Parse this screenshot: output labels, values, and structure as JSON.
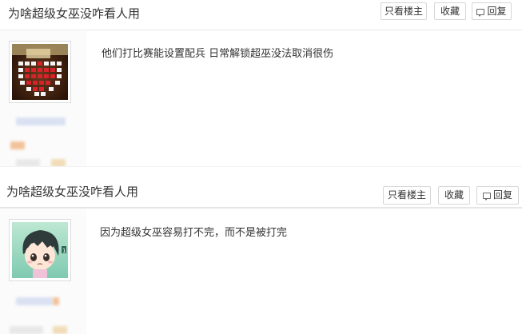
{
  "threads": [
    {
      "title": "为啥超级女巫没咋看人用",
      "buttons": {
        "only_op": "只看楼主",
        "favorite": "收藏",
        "reply": "回复"
      },
      "post": {
        "text": "他们打比赛能设置配兵 日常解锁超巫没法取消很伤"
      },
      "avatar_icon": "pixel-heart-avatar"
    },
    {
      "title": "为啥超级女巫没咋看人用",
      "buttons": {
        "only_op": "只看楼主",
        "favorite": "收藏",
        "reply": "回复"
      },
      "post": {
        "text": "因为超级女巫容易打不完，而不是被打完"
      },
      "avatar_icon": "anime-boy-avatar"
    }
  ],
  "colors": {
    "accent_blur": "#dbe3f3",
    "badge_orange": "#f3c9a0"
  }
}
